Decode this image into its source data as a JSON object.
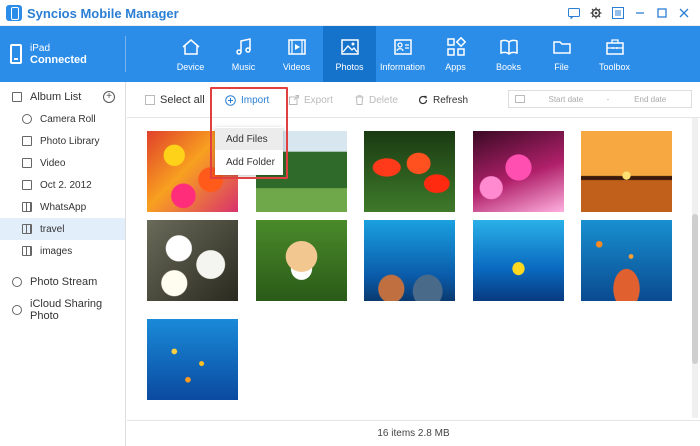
{
  "app": {
    "title": "Syncios Mobile Manager"
  },
  "window_controls": [
    "feedback-icon",
    "gear-icon",
    "menu-icon",
    "minimize-icon",
    "maximize-icon",
    "close-icon"
  ],
  "device": {
    "name": "iPad",
    "status": "Connected"
  },
  "nav": [
    {
      "id": "device",
      "label": "Device",
      "icon": "home-icon"
    },
    {
      "id": "music",
      "label": "Music",
      "icon": "music-note-icon"
    },
    {
      "id": "videos",
      "label": "Videos",
      "icon": "film-icon"
    },
    {
      "id": "photos",
      "label": "Photos",
      "icon": "image-icon",
      "active": true
    },
    {
      "id": "information",
      "label": "Information",
      "icon": "contact-card-icon"
    },
    {
      "id": "apps",
      "label": "Apps",
      "icon": "apps-grid-icon"
    },
    {
      "id": "books",
      "label": "Books",
      "icon": "book-icon"
    },
    {
      "id": "file",
      "label": "File",
      "icon": "folder-icon"
    },
    {
      "id": "toolbox",
      "label": "Toolbox",
      "icon": "toolbox-icon"
    }
  ],
  "sidebar": {
    "album_list_label": "Album List",
    "albums": [
      {
        "label": "Camera Roll",
        "icon": "camera-icon"
      },
      {
        "label": "Photo Library",
        "icon": "photo-library-icon"
      },
      {
        "label": "Video",
        "icon": "video-icon"
      },
      {
        "label": "Oct 2. 2012",
        "icon": "calendar-icon"
      },
      {
        "label": "WhatsApp",
        "icon": "album-icon"
      },
      {
        "label": "travel",
        "icon": "album-icon",
        "active": true
      },
      {
        "label": "images",
        "icon": "album-icon"
      }
    ],
    "photo_stream_label": "Photo Stream",
    "icloud_label": "iCloud Sharing Photo"
  },
  "toolbar": {
    "select_all": "Select all",
    "import": "Import",
    "export": "Export",
    "delete": "Delete",
    "refresh": "Refresh",
    "start_date": "Start date",
    "date_sep": "-",
    "end_date": "End date"
  },
  "import_menu": {
    "items": [
      "Add Files",
      "Add Folder"
    ]
  },
  "photos": [
    {
      "subject": "flowers-colorful"
    },
    {
      "subject": "park-trees"
    },
    {
      "subject": "tulips-red"
    },
    {
      "subject": "pink-flowers-bokeh"
    },
    {
      "subject": "sunset-water"
    },
    {
      "subject": "white-chrysanthemums"
    },
    {
      "subject": "puppy"
    },
    {
      "subject": "coral-reef"
    },
    {
      "subject": "tropical-fish"
    },
    {
      "subject": "reef-fish-school"
    },
    {
      "subject": "fish-school-blue"
    }
  ],
  "footer": {
    "status": "16 items 2.8 MB"
  },
  "colors": {
    "accent": "#2b8de8",
    "accent_dark": "#1673cc",
    "highlight": "#e04040"
  }
}
